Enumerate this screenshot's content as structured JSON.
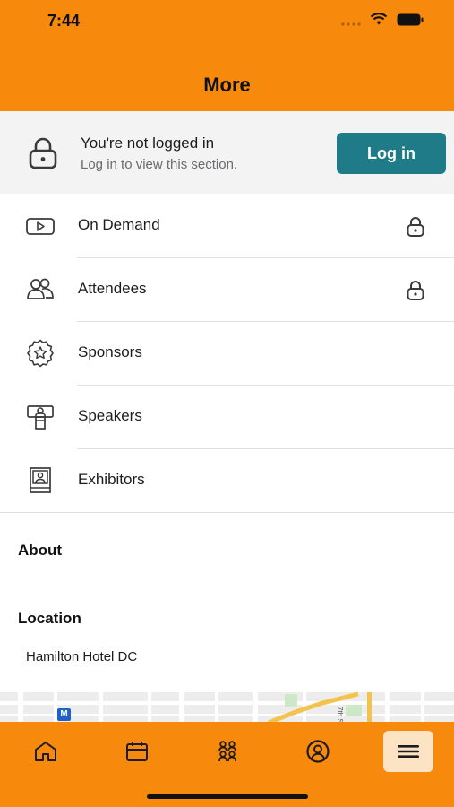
{
  "status_bar": {
    "time": "7:44"
  },
  "header": {
    "title": "More"
  },
  "login_banner": {
    "title": "You're not logged in",
    "subtitle": "Log in to view this section.",
    "button_label": "Log in"
  },
  "menu": {
    "items": [
      {
        "label": "On Demand",
        "icon": "play-video-icon",
        "locked": true
      },
      {
        "label": "Attendees",
        "icon": "people-icon",
        "locked": true
      },
      {
        "label": "Sponsors",
        "icon": "star-badge-icon",
        "locked": false
      },
      {
        "label": "Speakers",
        "icon": "podium-speaker-icon",
        "locked": false
      },
      {
        "label": "Exhibitors",
        "icon": "exhibitor-booth-icon",
        "locked": false
      }
    ]
  },
  "about": {
    "title": "About"
  },
  "location": {
    "title": "Location",
    "name": "Hamilton Hotel DC"
  },
  "map": {
    "metro_marker": "M",
    "street_label": "7th St"
  },
  "tabbar": {
    "tabs": [
      {
        "icon": "home-icon",
        "active": false
      },
      {
        "icon": "calendar-icon",
        "active": false
      },
      {
        "icon": "people-group-icon",
        "active": false
      },
      {
        "icon": "profile-icon",
        "active": false
      },
      {
        "icon": "menu-icon",
        "active": true
      }
    ]
  },
  "colors": {
    "brand": "#f7890c",
    "button": "#1f7b87",
    "active_tab_bg": "#fbe3c3"
  }
}
